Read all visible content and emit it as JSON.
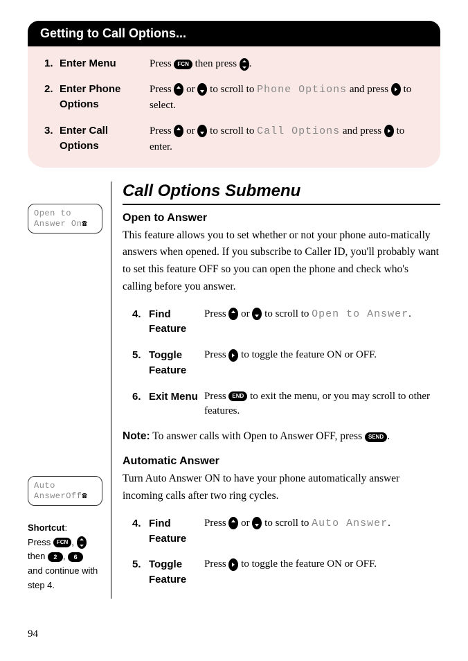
{
  "header": "Getting to Call Options...",
  "steps": [
    {
      "num": "1.",
      "label": "Enter Menu",
      "desc_a": "Press ",
      "desc_b": " then press ",
      "desc_c": ".",
      "key1": "FCN"
    },
    {
      "num": "2.",
      "label": "Enter Phone Options",
      "desc_a": "Press ",
      "desc_b": " or ",
      "desc_c": " to scroll to ",
      "menu": "Phone Options",
      "desc_d": " and press ",
      "desc_e": " to select."
    },
    {
      "num": "3.",
      "label": "Enter Call Options",
      "desc_a": "Press ",
      "desc_b": " or ",
      "desc_c": " to scroll to ",
      "menu": "Call Options",
      "desc_d": " and press ",
      "desc_e": " to enter."
    }
  ],
  "section_title": "Call Options Submenu",
  "open_answer": {
    "heading": "Open to Answer",
    "body": "This feature allows you to set whether or not your phone auto-matically answers when opened. If you subscribe to Caller ID, you'll probably want to set this feature OFF so you can open the phone and check who's calling before you answer.",
    "display_l1": "Open to",
    "display_l2": "Answer On"
  },
  "oa_steps": [
    {
      "num": "4.",
      "label": "Find Feature",
      "a": "Press ",
      "b": " or ",
      "c": " to scroll to ",
      "menu": "Open to Answer",
      "d": "."
    },
    {
      "num": "5.",
      "label": "Toggle Feature",
      "a": "Press ",
      "b": " to toggle the feature ON or OFF."
    },
    {
      "num": "6.",
      "label": "Exit Menu",
      "a": "Press ",
      "key": "END",
      "b": " to exit the menu, or you may scroll to other features."
    }
  ],
  "note": {
    "label": "Note:",
    "text": " To answer calls with Open to Answer OFF, press ",
    "key": "SEND",
    "end": "."
  },
  "auto_answer": {
    "heading": "Automatic Answer",
    "body": "Turn Auto Answer ON to have your phone automatically answer incoming calls after two ring cycles.",
    "display_l1": "Auto",
    "display_l2": "AnswerOff"
  },
  "aa_steps": [
    {
      "num": "4.",
      "label": "Find Feature",
      "a": "Press ",
      "b": " or ",
      "c": " to scroll to ",
      "menu": "Auto Answer",
      "d": "."
    },
    {
      "num": "5.",
      "label": "Toggle Feature",
      "a": "Press ",
      "b": " to toggle the feature ON or OFF."
    }
  ],
  "shortcut": {
    "label": "Shortcut",
    "a": "Press ",
    "key1": "FCN",
    "b": ", ",
    "c": " then ",
    "k2": "2",
    "d": ", ",
    "k6": "6",
    "e": " and continue with step 4."
  },
  "page_number": "94",
  "phone_icon_glyph": "☎"
}
